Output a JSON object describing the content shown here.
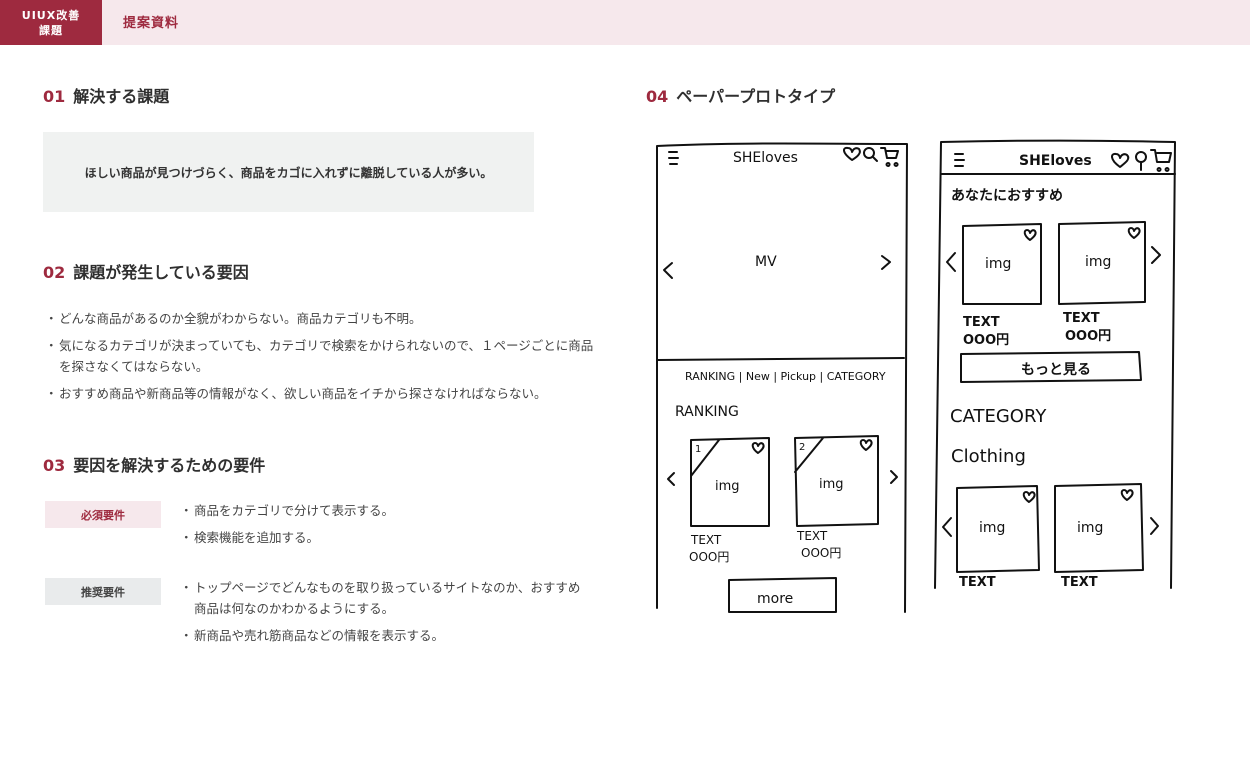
{
  "header": {
    "tag_line1": "UIUX改善",
    "tag_line2": "課題",
    "title": "提案資料"
  },
  "sections": {
    "s1": {
      "num": "01",
      "title": "解決する課題",
      "box_text": "ほしい商品が見つけづらく、商品をカゴに入れずに離脱している人が多い。"
    },
    "s2": {
      "num": "02",
      "title": "課題が発生している要因",
      "items": [
        "どんな商品があるのか全貌がわからない。商品カテゴリも不明。",
        "気になるカテゴリが決まっていても、カテゴリで検索をかけられないので、１ページごとに商品を探さなくてはならない。",
        "おすすめ商品や新商品等の情報がなく、欲しい商品をイチから探さなければならない。"
      ]
    },
    "s3": {
      "num": "03",
      "title": "要因を解決するための要件",
      "must_label": "必須要件",
      "must_items": [
        "商品をカテゴリで分けて表示する。",
        "検索機能を追加する。"
      ],
      "rec_label": "推奨要件",
      "rec_items": [
        "トップページでどんなものを取り扱っているサイトなのか、おすすめ商品は何なのかわかるようにする。",
        "新商品や売れ筋商品などの情報を表示する。"
      ]
    },
    "s4": {
      "num": "04",
      "title": "ペーパープロトタイプ"
    }
  },
  "sketch": {
    "left": {
      "logo": "SHEloves",
      "mv": "MV",
      "nav": "RANKING | New | Pickup | CATEGORY",
      "ranking": "RANKING",
      "rank1": "1",
      "rank2": "2",
      "img": "img",
      "text": "TEXT",
      "price": "OOO円",
      "more": "more"
    },
    "right": {
      "logo": "SHElovеs",
      "recommend": "あなたにおすすめ",
      "img": "img",
      "text": "TEXT",
      "price": "OOO円",
      "more": "もっと見る",
      "category": "CATEGORY",
      "clothing": "Clothing"
    }
  }
}
